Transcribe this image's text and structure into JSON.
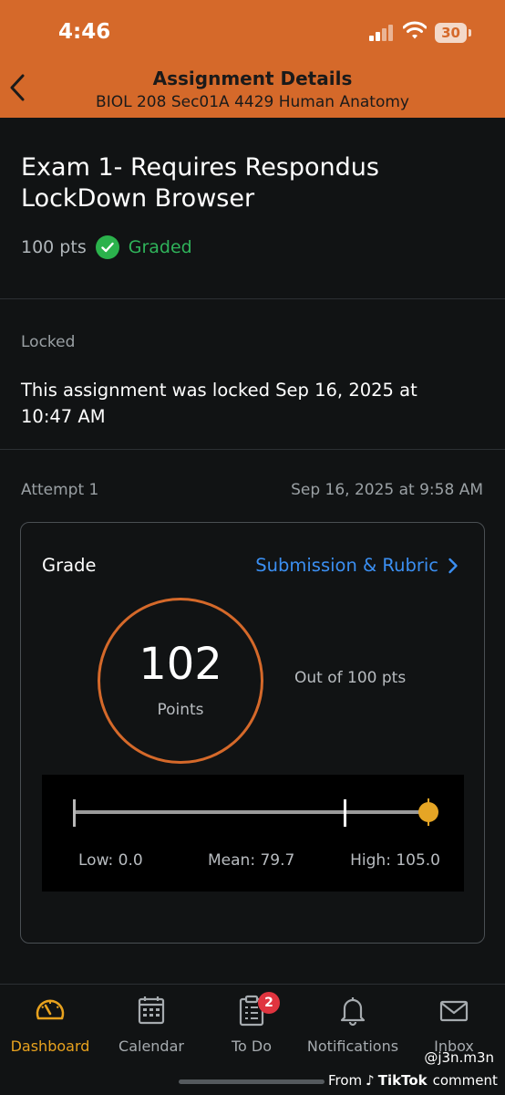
{
  "status_bar": {
    "time": "4:46",
    "battery": "30"
  },
  "nav": {
    "title": "Assignment Details",
    "subtitle": "BIOL 208 Sec01A 4429 Human Anatomy"
  },
  "assignment": {
    "title": "Exam 1- Requires Respondus LockDown Browser",
    "points": "100 pts",
    "status": "Graded"
  },
  "lock": {
    "label": "Locked",
    "message": "This assignment was locked Sep 16, 2025 at 10:47 AM"
  },
  "attempt": {
    "label": "Attempt 1",
    "date": "Sep 16, 2025 at 9:58 AM"
  },
  "grade": {
    "label": "Grade",
    "rubric_link": "Submission & Rubric",
    "score": "102",
    "score_unit": "Points",
    "out_of": "Out of 100 pts",
    "stats": {
      "low_label": "Low: 0.0",
      "mean_label": "Mean: 79.7",
      "high_label": "High: 105.0",
      "low": 0.0,
      "mean": 79.7,
      "high": 105.0,
      "score": 102
    }
  },
  "tabs": [
    {
      "label": "Dashboard",
      "icon": "speedometer-icon",
      "active": true
    },
    {
      "label": "Calendar",
      "icon": "calendar-icon"
    },
    {
      "label": "To Do",
      "icon": "clipboard-icon",
      "badge": "2"
    },
    {
      "label": "Notifications",
      "icon": "bell-icon"
    },
    {
      "label": "Inbox",
      "icon": "envelope-icon"
    }
  ],
  "watermark": {
    "handle": "@j3n.m3n",
    "from": "From",
    "brand": "TikTok",
    "suffix": "comment"
  },
  "colors": {
    "accent": "#d5692a",
    "link": "#3b8ff2",
    "graded_green": "#2bb24c",
    "active_tab": "#e8a21e",
    "badge": "#e0343f",
    "score_marker": "#e5a525"
  }
}
